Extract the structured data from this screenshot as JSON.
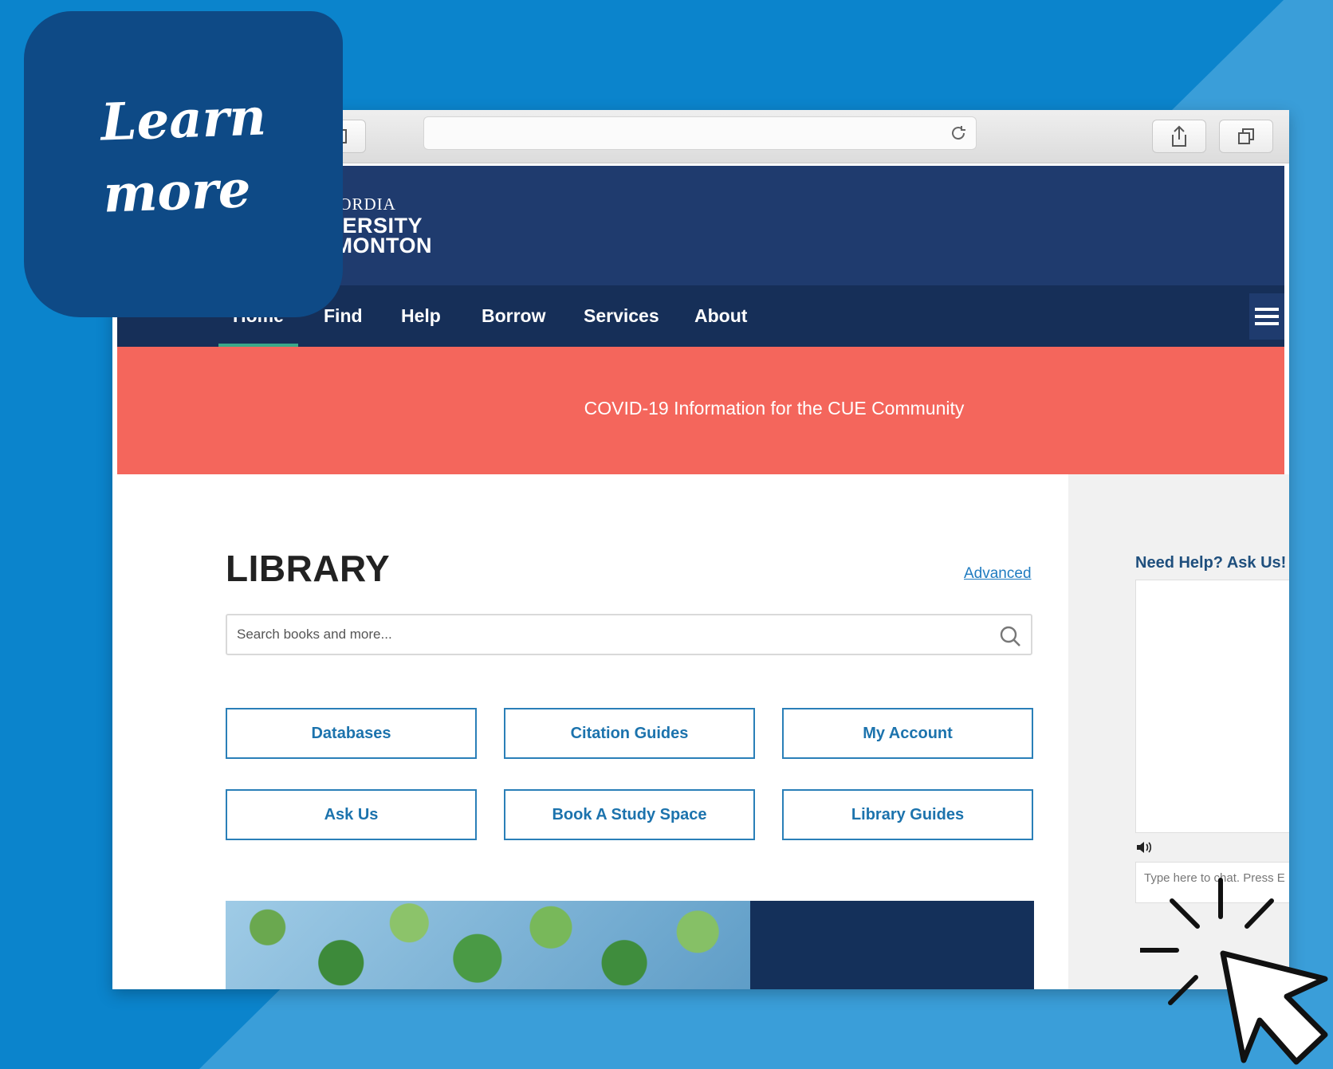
{
  "badge": {
    "line1": "Learn",
    "line2": "more"
  },
  "site": {
    "logo": {
      "line1": "CONCORDIA",
      "line2": "UNIVERSITY",
      "of": "OF",
      "line3": "EDMONTON"
    },
    "nav": [
      "Home",
      "Find",
      "Help",
      "Borrow",
      "Services",
      "About"
    ],
    "alert": "COVID-19 Information for the CUE Community"
  },
  "library": {
    "title": "LIBRARY",
    "advanced": "Advanced",
    "search_placeholder": "Search books and more...",
    "buttons": [
      "Databases",
      "Citation Guides",
      "My Account",
      "Ask Us",
      "Book A Study Space",
      "Library Guides"
    ]
  },
  "sidebar": {
    "help_title": "Need Help? Ask Us!",
    "chat_placeholder": "Type here to chat. Press E"
  },
  "colors": {
    "background": "#0b84cc",
    "header": "#1f3b6e",
    "nav": "#162f58",
    "alert": "#f4665c",
    "accent": "#1c73ad"
  }
}
